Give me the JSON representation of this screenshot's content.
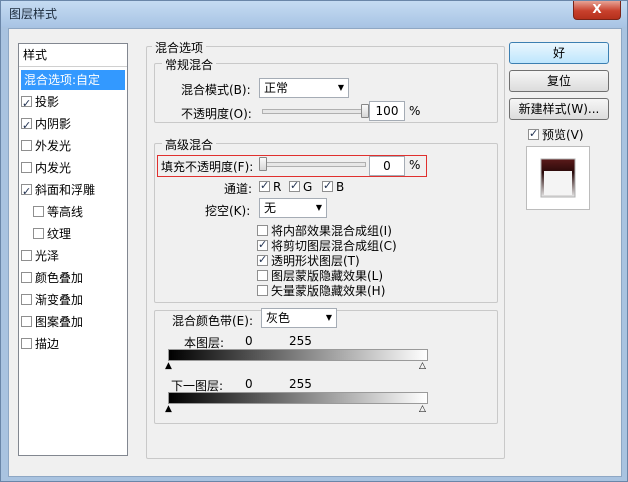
{
  "window": {
    "title": "图层样式",
    "close_glyph": "X"
  },
  "sidebar": {
    "header": "样式",
    "items": [
      {
        "label": "混合选项:自定",
        "selected": true
      },
      {
        "label": "投影",
        "checked": true
      },
      {
        "label": "内阴影",
        "checked": true
      },
      {
        "label": "外发光",
        "checked": false
      },
      {
        "label": "内发光",
        "checked": false
      },
      {
        "label": "斜面和浮雕",
        "checked": true
      },
      {
        "label": "等高线",
        "checked": false
      },
      {
        "label": "纹理",
        "checked": false
      },
      {
        "label": "光泽",
        "checked": false
      },
      {
        "label": "颜色叠加",
        "checked": false
      },
      {
        "label": "渐变叠加",
        "checked": false
      },
      {
        "label": "图案叠加",
        "checked": false
      },
      {
        "label": "描边",
        "checked": false
      }
    ]
  },
  "blend_options": {
    "title": "混合选项",
    "general": {
      "title": "常规混合",
      "blend_mode_label": "混合模式(B):",
      "blend_mode_value": "正常",
      "opacity_label": "不透明度(O):",
      "opacity_value": "100",
      "opacity_unit": "%",
      "opacity_fraction": 1.0
    },
    "advanced": {
      "title": "高级混合",
      "fill_opacity_label": "填充不透明度(F):",
      "fill_opacity_value": "0",
      "fill_opacity_unit": "%",
      "fill_opacity_fraction": 0.0,
      "channels_label": "通道:",
      "channel_r": "R",
      "channel_g": "G",
      "channel_b": "B",
      "knockout_label": "挖空(K):",
      "knockout_value": "无",
      "options": [
        {
          "label": "将内部效果混合成组(I)",
          "checked": false
        },
        {
          "label": "将剪切图层混合成组(C)",
          "checked": true
        },
        {
          "label": "透明形状图层(T)",
          "checked": true
        },
        {
          "label": "图层蒙版隐藏效果(L)",
          "checked": false
        },
        {
          "label": "矢量蒙版隐藏效果(H)",
          "checked": false
        }
      ]
    },
    "blend_if": {
      "label": "混合颜色带(E):",
      "value": "灰色",
      "this_layer_label": "本图层:",
      "this_layer_low": "0",
      "this_layer_high": "255",
      "underlying_label": "下一图层:",
      "underlying_low": "0",
      "underlying_high": "255"
    }
  },
  "buttons": {
    "ok": "好",
    "reset": "复位",
    "new_style": "新建样式(W)...",
    "preview": "预览(V)"
  },
  "colors": {
    "accent": "#3399ff",
    "highlight": "#e0302e"
  }
}
